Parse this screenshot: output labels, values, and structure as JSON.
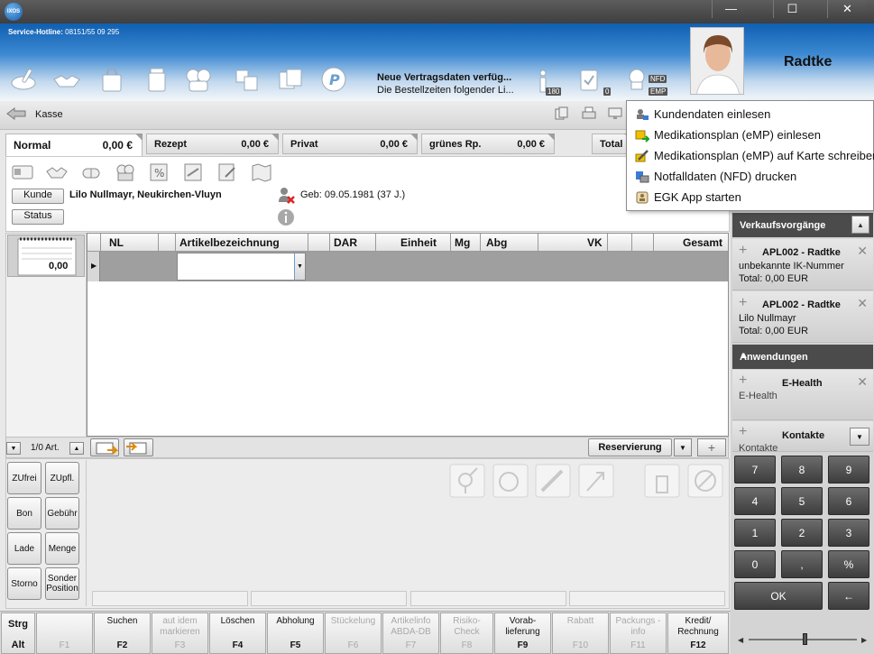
{
  "window": {
    "logo_text": "IXOS",
    "minimize_glyph": "—",
    "maximize_glyph": "☐",
    "close_glyph": "✕"
  },
  "header": {
    "hotline_label": "Service-Hotline:",
    "hotline_number": "08151/55 09 295",
    "news_title": "Neue Vertragsdaten verfüg...",
    "news_text": "Die Bestellzeiten folgender Li...",
    "badge_info": "180",
    "badge_clipboard": "0",
    "badge_nfd": "NFD",
    "badge_emp": "EMP",
    "user_name": "Radtke"
  },
  "kasse": {
    "label": "Kasse"
  },
  "tabs": [
    {
      "label": "Normal",
      "value": "0,00 €"
    },
    {
      "label": "Rezept",
      "value": "0,00 €"
    },
    {
      "label": "Privat",
      "value": "0,00 €"
    },
    {
      "label": "grünes Rp.",
      "value": "0,00 €"
    },
    {
      "label": "Total",
      "value": ""
    }
  ],
  "customer": {
    "kunde_button": "Kunde",
    "status_button": "Status",
    "name": "Lilo Nullmayr, Neukirchen-Vluyn",
    "birth": "Geb: 09.05.1981 (37 J.)"
  },
  "left_panel": {
    "notepad_value": "0,00",
    "count_label": "1/0 Art."
  },
  "grid": {
    "columns": [
      "NL",
      "Artikelbezeichnung",
      "DAR",
      "Einheit",
      "Mg",
      "Abg",
      "VK",
      "Gesamt"
    ]
  },
  "grid_footer": {
    "reservation_label": "Reservierung"
  },
  "side_buttons": [
    [
      "ZUfrei",
      "ZUpfl."
    ],
    [
      "Bon",
      "Gebühr"
    ],
    [
      "Lade",
      "Menge"
    ],
    [
      "Storno",
      "Sonder Position"
    ]
  ],
  "fkeys": [
    {
      "text": "Strg",
      "key": "Alt",
      "enabled": true,
      "modifier": true
    },
    {
      "text": "",
      "key": "F1",
      "enabled": false
    },
    {
      "text": "Suchen",
      "key": "F2",
      "enabled": true
    },
    {
      "text": "aut idem markieren",
      "key": "F3",
      "enabled": false
    },
    {
      "text": "Löschen",
      "key": "F4",
      "enabled": true
    },
    {
      "text": "Abholung",
      "key": "F5",
      "enabled": true
    },
    {
      "text": "Stückelung",
      "key": "F6",
      "enabled": false
    },
    {
      "text": "Artikelinfo ABDA-DB",
      "key": "F7",
      "enabled": false
    },
    {
      "text": "Risiko-Check",
      "key": "F8",
      "enabled": false
    },
    {
      "text": "Vorab-lieferung",
      "key": "F9",
      "enabled": true
    },
    {
      "text": "Rabatt",
      "key": "F10",
      "enabled": false
    },
    {
      "text": "Packungs - info",
      "key": "F11",
      "enabled": false
    },
    {
      "text": "Kredit/ Rechnung",
      "key": "F12",
      "enabled": true
    }
  ],
  "right_panel": {
    "verkauf_header": "Verkaufsvorgänge",
    "verkauf_items": [
      {
        "title": "APL002 - Radtke",
        "line1": "unbekannte IK-Nummer",
        "line2": "Total: 0,00 EUR"
      },
      {
        "title": "APL002 - Radtke",
        "line1": "Lilo Nullmayr",
        "line2": "Total: 0,00 EUR"
      }
    ],
    "anwendungen_header": "Anwendungen",
    "apps": [
      {
        "title": "E-Health",
        "sub": "E-Health"
      },
      {
        "title": "Kontakte",
        "sub": "Kontakte"
      }
    ],
    "numpad": [
      "7",
      "8",
      "9",
      "4",
      "5",
      "6",
      "1",
      "2",
      "3",
      "0",
      ",",
      "%"
    ],
    "ok_label": "OK",
    "back_label": "←"
  },
  "context_menu": [
    {
      "label": "Kundendaten einlesen",
      "icon": "card-reader-icon"
    },
    {
      "label": "Medikationsplan (eMP) einlesen",
      "icon": "emp-read-icon"
    },
    {
      "label": "Medikationsplan (eMP) auf Karte schreiben",
      "icon": "emp-write-icon"
    },
    {
      "label": "Notfalldaten (NFD) drucken",
      "icon": "nfd-print-icon"
    },
    {
      "label": "EGK App starten",
      "icon": "egk-app-icon"
    }
  ],
  "colors": {
    "header_blue": "#0f5fb2",
    "dark_panel": "#4b4b4b",
    "numpad": "#4a4a4a"
  }
}
